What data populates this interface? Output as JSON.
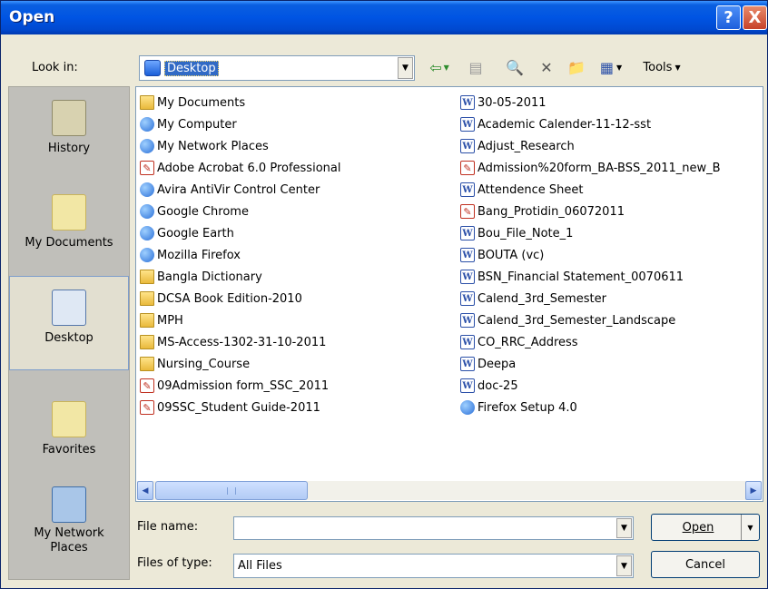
{
  "window": {
    "title": "Open",
    "help_glyph": "?",
    "close_glyph": "X"
  },
  "look_in": {
    "label": "Look in:",
    "value": "Desktop"
  },
  "toolbar": {
    "back_glyph": "⇦",
    "up_glyph": "▤",
    "search_glyph": "🔍",
    "delete_glyph": "✕",
    "newfolder_glyph": "📁",
    "views_glyph": "▦",
    "tools_label": "Tools"
  },
  "places": [
    {
      "name": "history",
      "label": "History",
      "icon": "history-icon",
      "color": "#d8d2b0"
    },
    {
      "name": "my-documents",
      "label": "My Documents",
      "icon": "my-documents-icon",
      "color": "#f2e7a5"
    },
    {
      "name": "desktop",
      "label": "Desktop",
      "icon": "desktop-icon",
      "color": "#dfe8f4"
    },
    {
      "name": "favorites",
      "label": "Favorites",
      "icon": "favorites-icon",
      "color": "#f2e7a5"
    },
    {
      "name": "my-network-places",
      "label": "My Network Places",
      "icon": "my-network-places-icon",
      "color": "#a9c6e8"
    }
  ],
  "files_col1": [
    {
      "name": "My Documents",
      "icon": "folder"
    },
    {
      "name": "My Computer",
      "icon": "app"
    },
    {
      "name": "My Network Places",
      "icon": "app"
    },
    {
      "name": "Adobe Acrobat 6.0 Professional",
      "icon": "pdf"
    },
    {
      "name": "Avira AntiVir Control Center",
      "icon": "app"
    },
    {
      "name": "Google Chrome",
      "icon": "app"
    },
    {
      "name": "Google Earth",
      "icon": "app"
    },
    {
      "name": "Mozilla Firefox",
      "icon": "app"
    },
    {
      "name": "Bangla Dictionary",
      "icon": "folder"
    },
    {
      "name": "DCSA Book Edition-2010",
      "icon": "folder"
    },
    {
      "name": "MPH",
      "icon": "folder"
    },
    {
      "name": "MS-Access-1302-31-10-2011",
      "icon": "folder"
    },
    {
      "name": "Nursing_Course",
      "icon": "folder"
    },
    {
      "name": "09Admission form_SSC_2011",
      "icon": "pdf"
    },
    {
      "name": "09SSC_Student Guide-2011",
      "icon": "pdf"
    }
  ],
  "files_col2": [
    {
      "name": "30-05-2011",
      "icon": "word"
    },
    {
      "name": "Academic Calender-11-12-sst",
      "icon": "word"
    },
    {
      "name": "Adjust_Research",
      "icon": "word"
    },
    {
      "name": "Admission%20form_BA-BSS_2011_new_B",
      "icon": "pdf"
    },
    {
      "name": "Attendence Sheet",
      "icon": "word"
    },
    {
      "name": "Bang_Protidin_06072011",
      "icon": "pdf"
    },
    {
      "name": "Bou_File_Note_1",
      "icon": "word"
    },
    {
      "name": "BOUTA (vc)",
      "icon": "word"
    },
    {
      "name": "BSN_Financial Statement_0070611",
      "icon": "word"
    },
    {
      "name": "Calend_3rd_Semester",
      "icon": "word"
    },
    {
      "name": "Calend_3rd_Semester_Landscape",
      "icon": "word"
    },
    {
      "name": "CO_RRC_Address",
      "icon": "word"
    },
    {
      "name": "Deepa",
      "icon": "word"
    },
    {
      "name": "doc-25",
      "icon": "word"
    },
    {
      "name": "Firefox Setup 4.0",
      "icon": "app"
    }
  ],
  "file_name": {
    "label": "File name:",
    "value": ""
  },
  "file_type": {
    "label": "Files of type:",
    "value": "All Files"
  },
  "buttons": {
    "open": "Open",
    "cancel": "Cancel"
  },
  "colors": {
    "title_bar": "#0054e3",
    "selection": "#316ac5",
    "panel": "#ece9d8"
  }
}
